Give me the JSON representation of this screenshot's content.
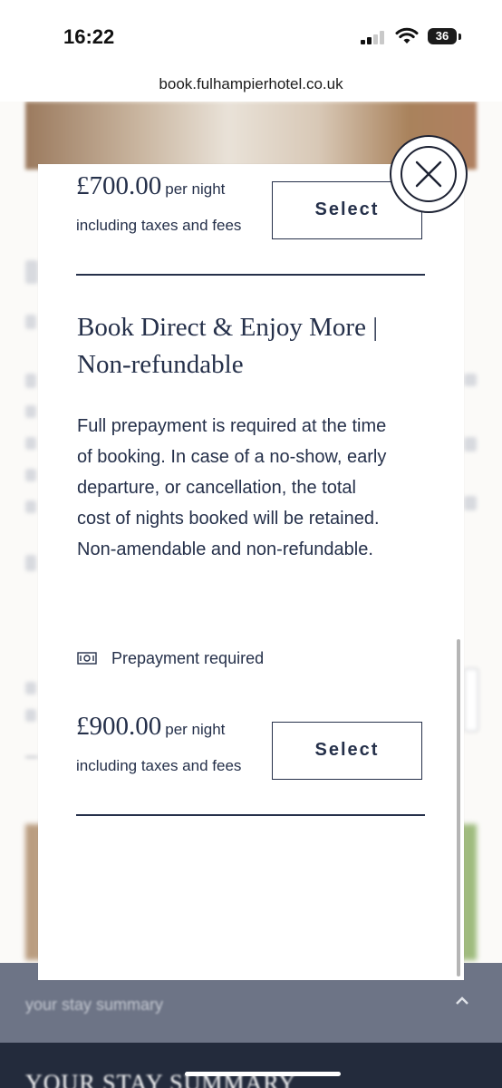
{
  "status_bar": {
    "time": "16:22",
    "battery": "36"
  },
  "browser": {
    "url": "book.fulhampierhotel.co.uk"
  },
  "background": {
    "summary_bar_label": "your stay summary",
    "summary_title": "YOUR STAY SUMMARY"
  },
  "modal": {
    "rate_1": {
      "price": "£700.00",
      "per_night": "per night",
      "taxes": "including taxes and fees",
      "select_label": "Select"
    },
    "rate_2": {
      "title": "Book Direct & Enjoy More | Non-refundable",
      "description": "Full prepayment is required at the time of booking. In case of a no-show, early departure, or cancellation, the total cost of nights booked will be retained. Non-amendable and non-refundable.",
      "prepayment_label": "Prepayment required",
      "price": "£900.00",
      "per_night": "per night",
      "taxes": "including taxes and fees",
      "select_label": "Select"
    }
  },
  "colors": {
    "navy": "#25304a",
    "overlay_bar": "#6d7486",
    "bottom_panel": "#232b3c"
  }
}
